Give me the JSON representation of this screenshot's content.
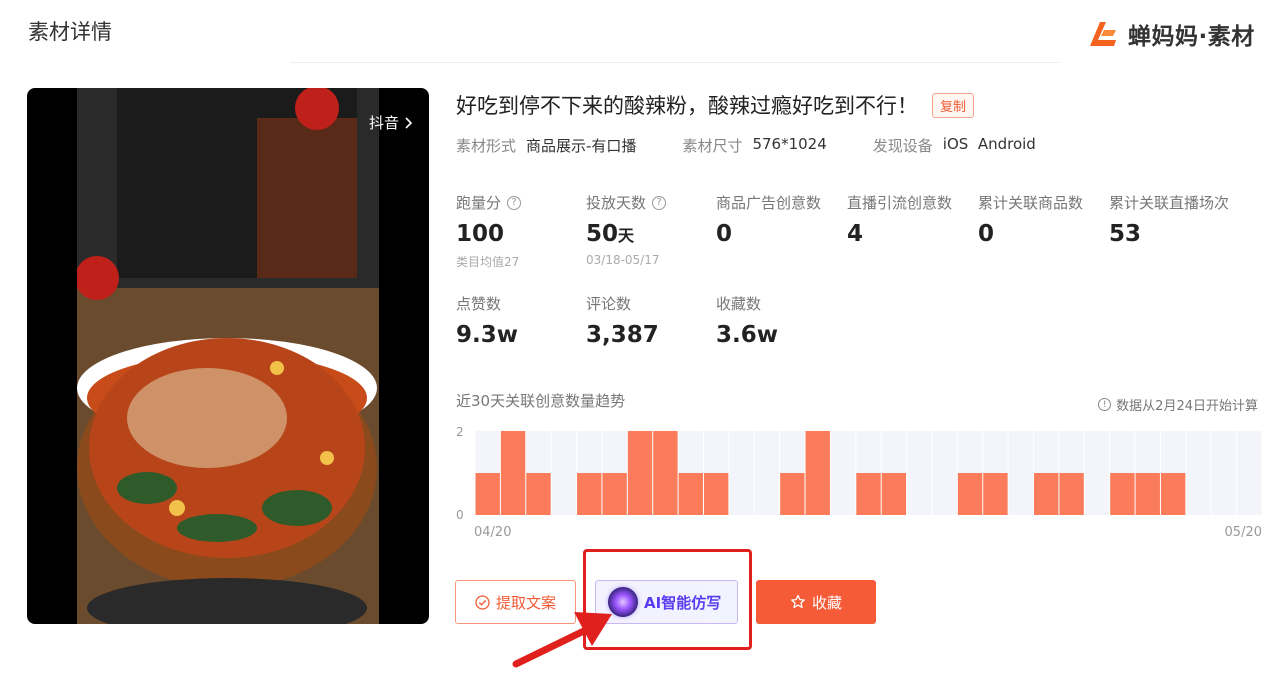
{
  "header": {
    "page_title": "素材详情",
    "brand_text": "蝉妈妈·素材"
  },
  "video": {
    "platform": "抖音",
    "platform_icon": "chevron-right-icon"
  },
  "material": {
    "title": "好吃到停不下来的酸辣粉，酸辣过瘾好吃到不行！",
    "copy_label": "复制",
    "meta": [
      {
        "key": "素材形式",
        "value": "商品展示-有口播"
      },
      {
        "key": "素材尺寸",
        "value": "576*1024"
      },
      {
        "key": "发现设备",
        "value": "iOS  Android"
      }
    ]
  },
  "stats": {
    "run_score": {
      "label": "跑量分",
      "value": "100",
      "sub": "类目均值27"
    },
    "days": {
      "label": "投放天数",
      "value": "50",
      "unit": "天",
      "sub": "03/18-05/17"
    },
    "product_ad": {
      "label": "商品广告创意数",
      "value": "0"
    },
    "live_traffic": {
      "label": "直播引流创意数",
      "value": "4"
    },
    "linked_products": {
      "label": "累计关联商品数",
      "value": "0"
    },
    "linked_lives": {
      "label": "累计关联直播场次",
      "value": "53"
    },
    "likes": {
      "label": "点赞数",
      "value": "9.3w"
    },
    "comments": {
      "label": "评论数",
      "value": "3,387"
    },
    "favorites": {
      "label": "收藏数",
      "value": "3.6w"
    }
  },
  "trend": {
    "title": "近30天关联创意数量趋势",
    "note": "数据从2月24日开始计算"
  },
  "chart_data": {
    "type": "bar",
    "title": "近30天关联创意数量趋势",
    "x_start_label": "04/20",
    "x_end_label": "05/20",
    "ylim": [
      0,
      2
    ],
    "y_ticks": [
      "0",
      "2"
    ],
    "values": [
      1,
      2,
      1,
      0,
      1,
      1,
      2,
      2,
      1,
      1,
      0,
      0,
      1,
      2,
      0,
      1,
      1,
      0,
      0,
      1,
      1,
      0,
      1,
      1,
      0,
      1,
      1,
      1,
      0,
      0,
      0
    ],
    "bar_color": "#fa7c5a",
    "background_color": "#f3f5fa"
  },
  "actions": {
    "extract_label": "提取文案",
    "ai_label": "AI智能仿写",
    "favorite_label": "收藏"
  },
  "colors": {
    "accent": "#f45b36",
    "highlight": "#e0201d",
    "ai_purple": "#5a3df0"
  }
}
